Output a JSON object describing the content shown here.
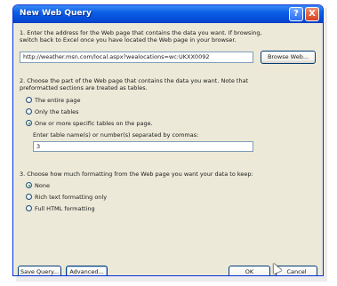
{
  "window": {
    "title": "New Web Query",
    "help_glyph": "?",
    "close_glyph": "X"
  },
  "step1": {
    "line1": "1. Enter the address for the Web page that contains the data you want.  If browsing,",
    "line2": "switch back to Excel once you have located the Web page in your browser.",
    "url_value": "http://weather.msn.com/local.aspx?wealocations=wc:UKXX0092",
    "browse_label": "Browse Web..."
  },
  "step2": {
    "line1": "2. Choose the part of the Web page that contains the data you want.  Note that",
    "line2": "preformatted sections are treated as tables.",
    "options": [
      {
        "label": "The entire page",
        "checked": false
      },
      {
        "label": "Only the tables",
        "checked": false
      },
      {
        "label": "One or more specific tables on the page.",
        "checked": true
      }
    ],
    "tables_label": "Enter table name(s) or number(s) separated by commas:",
    "tables_value": "3"
  },
  "step3": {
    "line1": "3. Choose how much formatting from the Web page you want your data to keep:",
    "options": [
      {
        "label": "None",
        "checked": true
      },
      {
        "label": "Rich text formatting only",
        "checked": false
      },
      {
        "label": "Full HTML formatting",
        "checked": false
      }
    ]
  },
  "buttons": {
    "save_query": "Save Query...",
    "advanced": "Advanced...",
    "ok": "OK",
    "cancel": "Cancel"
  },
  "colors": {
    "titlebar": "#0a5fe6",
    "dialog_bg": "#ece9d8",
    "close_button": "#d8431f"
  }
}
